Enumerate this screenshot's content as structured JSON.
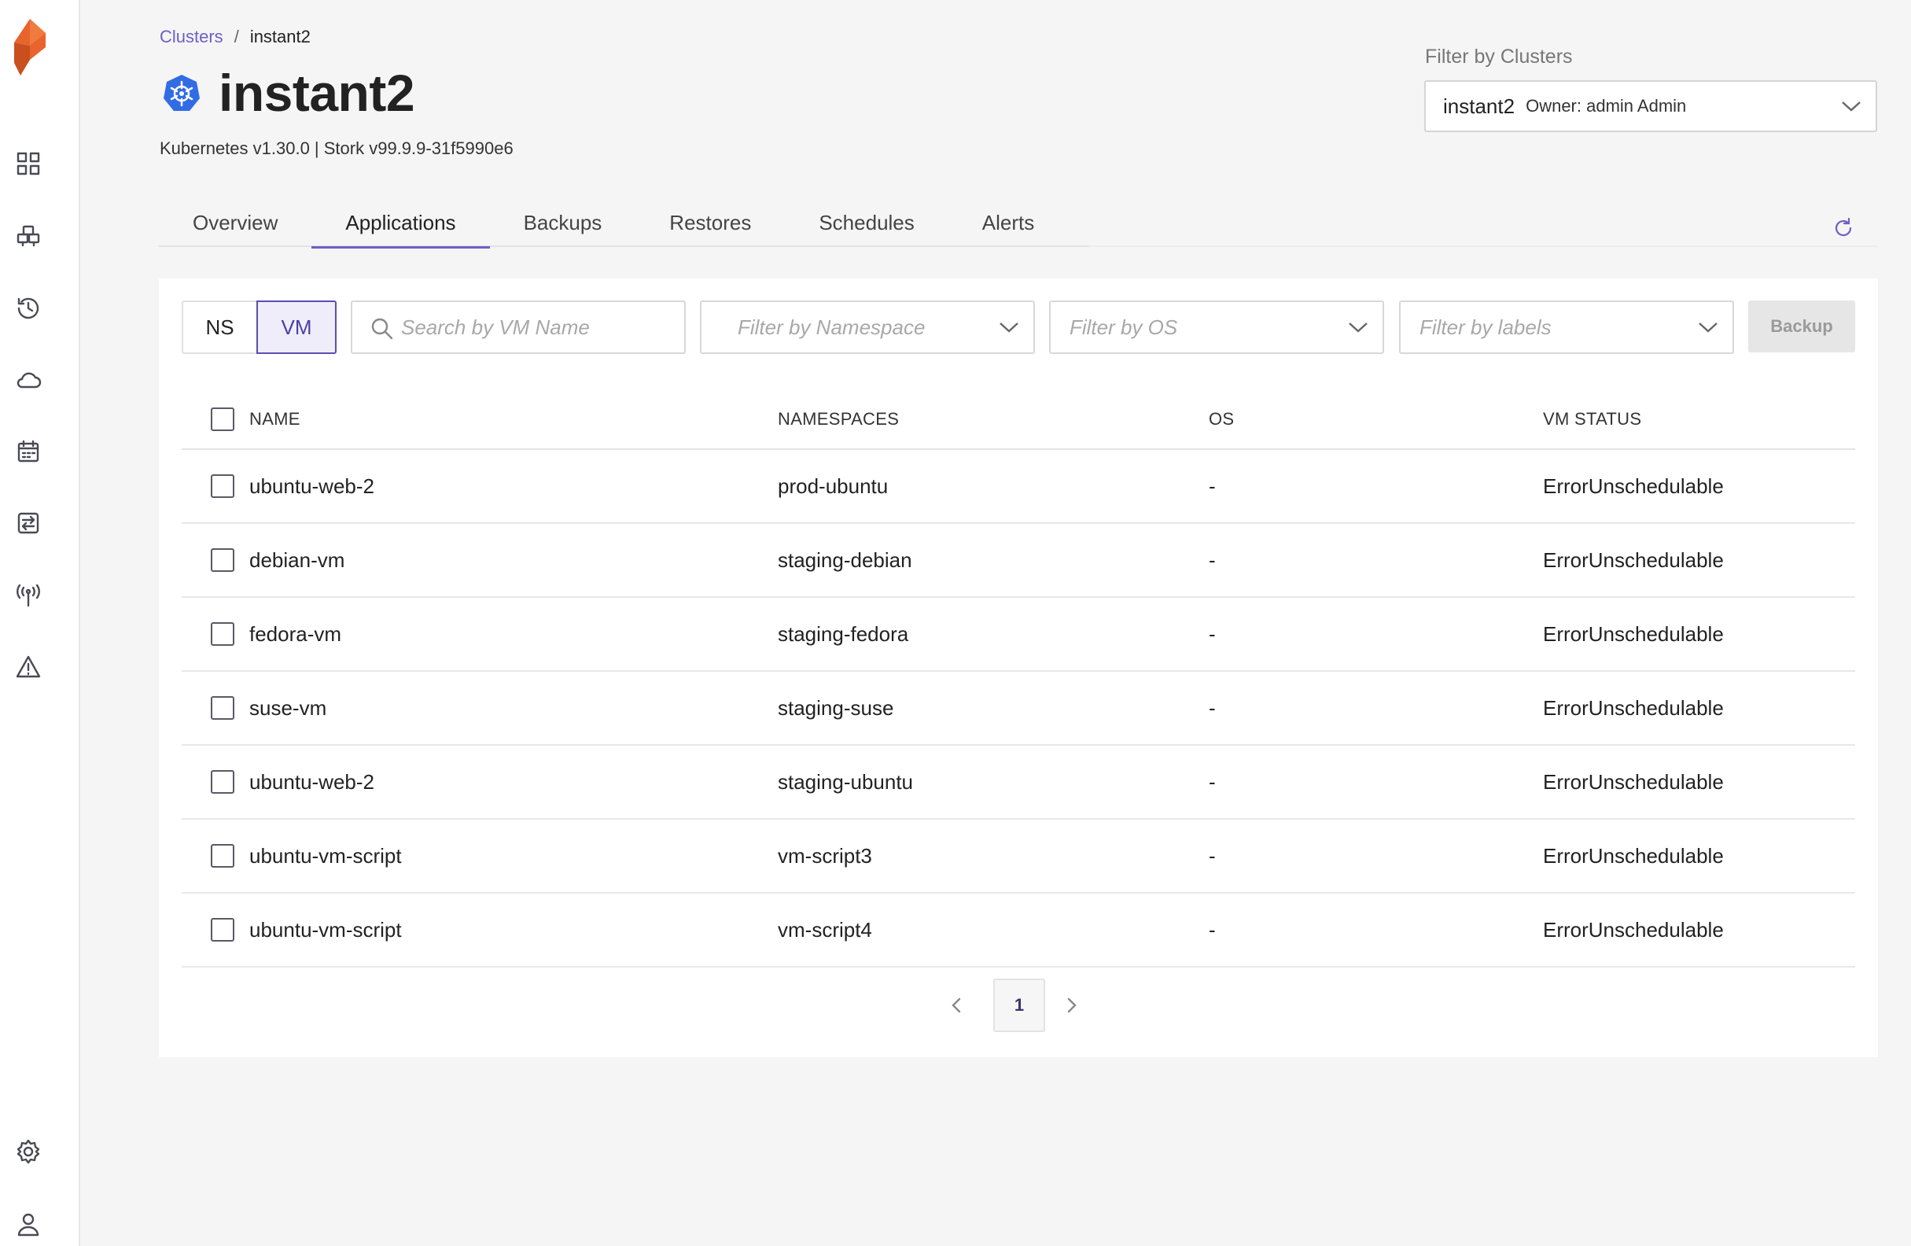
{
  "breadcrumb": {
    "parent": "Clusters",
    "separator": "/",
    "current": "instant2"
  },
  "page": {
    "title": "instant2",
    "subtitle": "Kubernetes v1.30.0 | Stork v99.9.9-31f5990e6"
  },
  "cluster_filter": {
    "label": "Filter by Clusters",
    "selected_name": "instant2",
    "selected_owner": "Owner: admin Admin"
  },
  "tabs": [
    {
      "label": "Overview"
    },
    {
      "label": "Applications",
      "active": true
    },
    {
      "label": "Backups"
    },
    {
      "label": "Restores"
    },
    {
      "label": "Schedules"
    },
    {
      "label": "Alerts"
    }
  ],
  "toolbar": {
    "ns_label": "NS",
    "vm_label": "VM",
    "search_placeholder": "Search by VM Name",
    "namespace_placeholder": "Filter by Namespace",
    "os_placeholder": "Filter by OS",
    "labels_placeholder": "Filter by labels",
    "backup_label": "Backup"
  },
  "table": {
    "headers": {
      "name": "NAME",
      "namespaces": "NAMESPACES",
      "os": "OS",
      "status": "VM STATUS"
    },
    "rows": [
      {
        "name": "ubuntu-web-2",
        "namespace": "prod-ubuntu",
        "os": "-",
        "status": "ErrorUnschedulable"
      },
      {
        "name": "debian-vm",
        "namespace": "staging-debian",
        "os": "-",
        "status": "ErrorUnschedulable"
      },
      {
        "name": "fedora-vm",
        "namespace": "staging-fedora",
        "os": "-",
        "status": "ErrorUnschedulable"
      },
      {
        "name": "suse-vm",
        "namespace": "staging-suse",
        "os": "-",
        "status": "ErrorUnschedulable"
      },
      {
        "name": "ubuntu-web-2",
        "namespace": "staging-ubuntu",
        "os": "-",
        "status": "ErrorUnschedulable"
      },
      {
        "name": "ubuntu-vm-script",
        "namespace": "vm-script3",
        "os": "-",
        "status": "ErrorUnschedulable"
      },
      {
        "name": "ubuntu-vm-script",
        "namespace": "vm-script4",
        "os": "-",
        "status": "ErrorUnschedulable"
      }
    ]
  },
  "pagination": {
    "current_page": "1"
  },
  "sidebar_icons": [
    "dashboard-icon",
    "applications-icon",
    "history-icon",
    "cloud-icon",
    "calendar-icon",
    "policy-icon",
    "antenna-icon",
    "alert-icon",
    "settings-icon",
    "user-icon"
  ],
  "colors": {
    "accent": "#6c5fc7",
    "logo_orange": "#e8642c",
    "kubernetes_blue": "#326ce5"
  }
}
